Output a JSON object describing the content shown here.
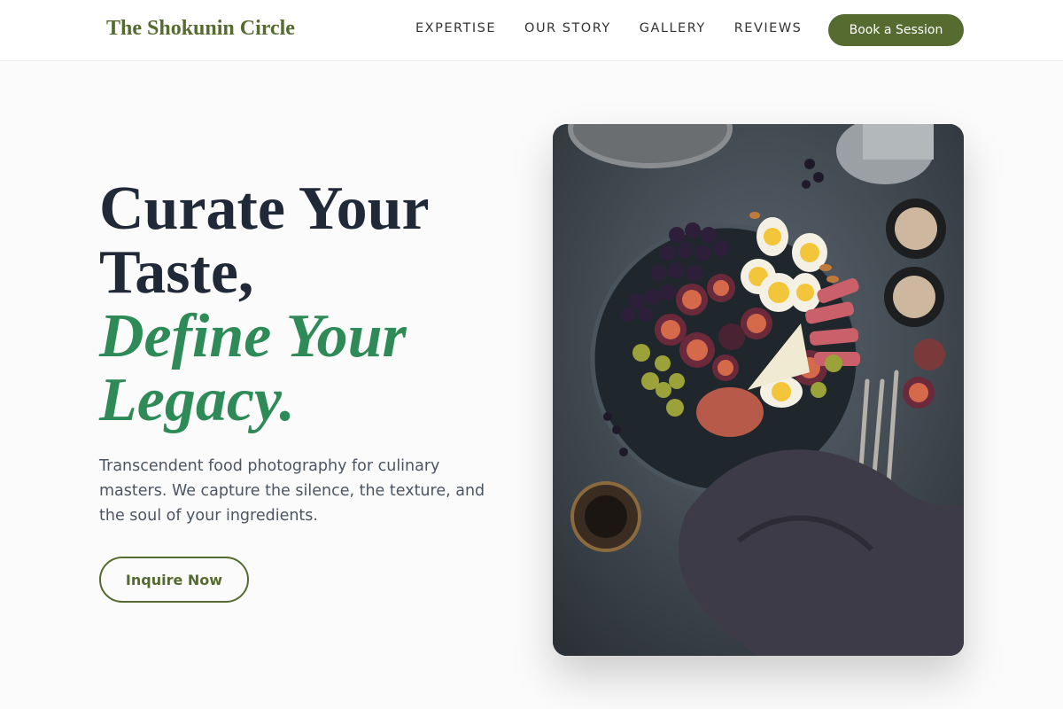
{
  "header": {
    "logo": "The Shokunin Circle",
    "nav": [
      "EXPERTISE",
      "OUR STORY",
      "GALLERY",
      "REVIEWS"
    ],
    "cta": "Book a Session"
  },
  "hero": {
    "line1": "Curate Your",
    "line2": "Taste,",
    "line3": "Define Your",
    "line4": "Legacy.",
    "subtext": "Transcendent food photography for culinary masters. We capture the silence, the texture, and the soul of your ingredients.",
    "cta": "Inquire Now"
  },
  "image": {
    "icon": "food-platter-photo"
  },
  "colors": {
    "brand": "#556b2f",
    "accent": "#2e8b57",
    "heading": "#1f2937",
    "body": "#4b5563"
  }
}
